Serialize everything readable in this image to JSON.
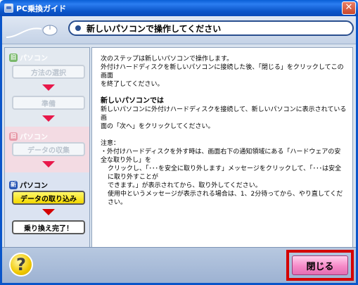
{
  "window": {
    "title": "PC乗換ガイド",
    "close_glyph": "✕"
  },
  "header": {
    "title": "新しいパソコンで操作してください"
  },
  "sidebar": {
    "old_section_label": "パソコン",
    "old_badge": "旧",
    "step1": "方法の選択",
    "step2": "準備",
    "old_section2_label": "パソコン",
    "step3": "データの収集",
    "new_section_label": "パソコン",
    "new_badge": "新",
    "step4": "データの取り込み",
    "step5": "乗り換え完了！"
  },
  "content": {
    "intro_line1": "次のステップは新しいパソコンで操作します。",
    "intro_line2": "外付けハードディスクを新しいパソコンに接続した後、「閉じる」をクリックしてこの画面",
    "intro_line3": "を終了してください。",
    "section_heading": "新しいパソコンでは",
    "section_line1": "新しいパソコンに外付けハードディスクを接続して、新しいパソコンに表示されている画",
    "section_line2": "面の「次へ」をクリックしてください。",
    "note_label": "注意",
    "note_line1": "・外付けハードディスクを外す時は、画面右下の通知領域にある「ハードウェアの安全な取り外し」を",
    "note_line2": "クリックし、「･･･を安全に取り外します」メッセージをクリックして、「･･･は安全に取り外すことが",
    "note_line3": "できます。」が表示されてから、取り外してください。",
    "note_line4": "使用中というメッセージが表示される場合は、1、2分待ってから、やり直してください。"
  },
  "footer": {
    "help_glyph": "?",
    "close_label": "閉じる"
  },
  "colors": {
    "accent_red": "#d40000",
    "active_step_yellow": "#f4d800",
    "close_button_pink": "#f68ac8",
    "arrow_red": "#e8184a"
  }
}
